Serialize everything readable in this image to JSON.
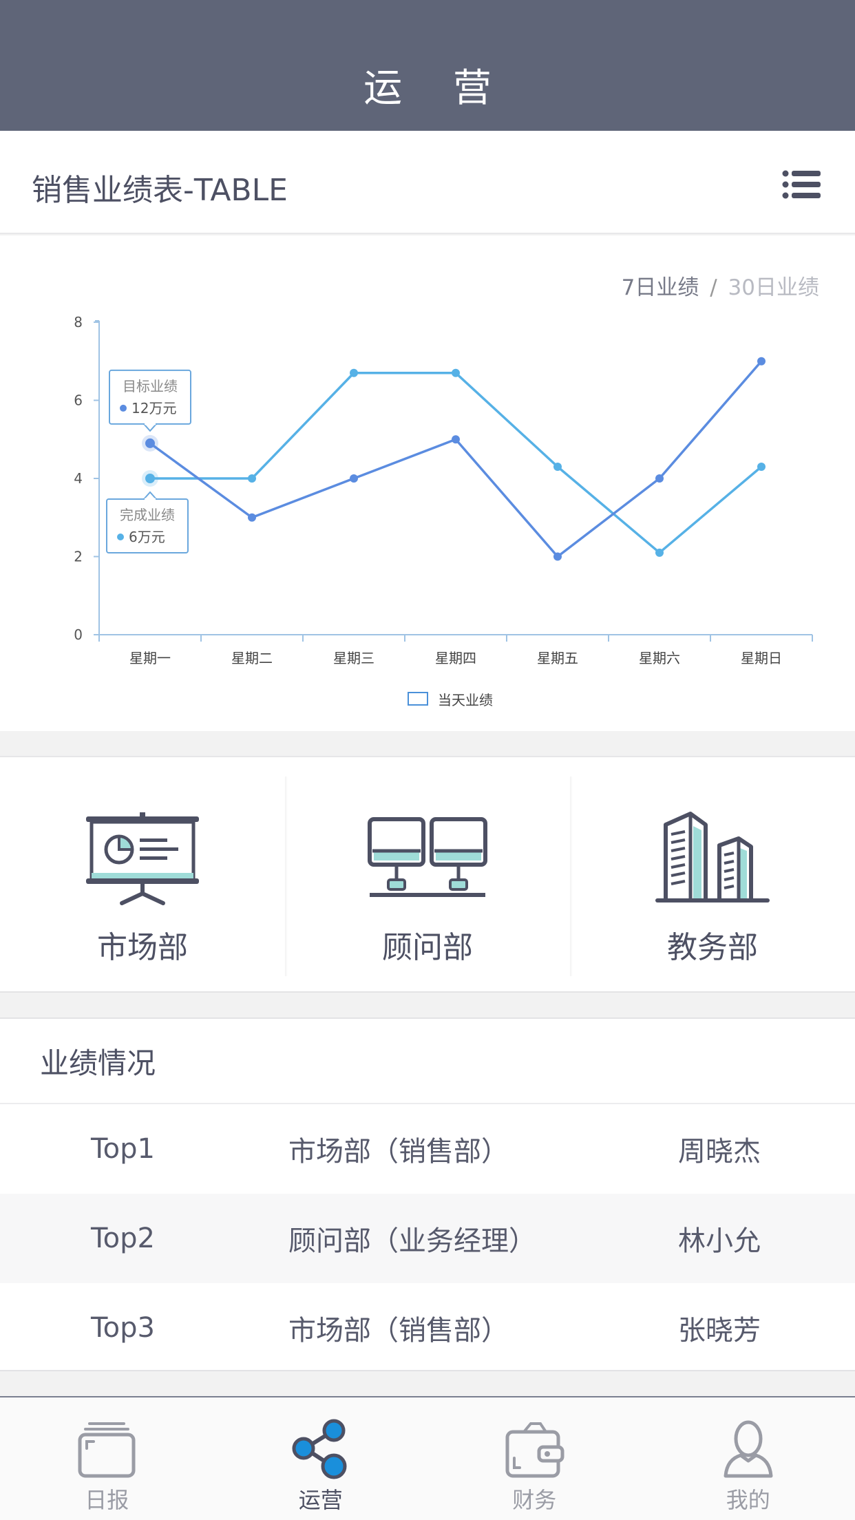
{
  "header": {
    "title": "运 营"
  },
  "card": {
    "title": "销售业绩表-TABLE",
    "menu_icon": "list-icon"
  },
  "range": {
    "active": "7日业绩",
    "separator": "/",
    "inactive": "30日业绩"
  },
  "chart_data": {
    "type": "line",
    "categories": [
      "星期一",
      "星期二",
      "星期三",
      "星期四",
      "星期五",
      "星期六",
      "星期日"
    ],
    "ylim": [
      0,
      8
    ],
    "yticks": [
      0,
      2,
      4,
      6,
      8
    ],
    "grid": false,
    "legend": {
      "label": "当天业绩",
      "placement": "bottom-center"
    },
    "series": [
      {
        "values": [
          4.9,
          3.0,
          4.0,
          5.0,
          2.0,
          4.0,
          7.0
        ],
        "color": "#5b8ce0"
      },
      {
        "values": [
          4.0,
          4.0,
          6.7,
          6.7,
          4.3,
          2.1,
          4.3
        ],
        "color": "#56b1e6"
      }
    ],
    "tooltips": [
      {
        "title": "目标业绩",
        "value": "12万元",
        "color": "#5b8ce0"
      },
      {
        "title": "完成业绩",
        "value": "6万元",
        "color": "#56b1e6"
      }
    ]
  },
  "departments": [
    {
      "label": "市场部",
      "icon": "presentation-board-icon"
    },
    {
      "label": "顾问部",
      "icon": "networked-computers-icon"
    },
    {
      "label": "教务部",
      "icon": "office-buildings-icon"
    }
  ],
  "performance": {
    "title": "业绩情况",
    "rows": [
      {
        "rank": "Top1",
        "dept": "市场部（销售部）",
        "name": "周晓杰"
      },
      {
        "rank": "Top2",
        "dept": "顾问部（业务经理）",
        "name": "林小允"
      },
      {
        "rank": "Top3",
        "dept": "市场部（销售部）",
        "name": "张晓芳"
      }
    ]
  },
  "tabs": [
    {
      "label": "日报",
      "icon": "report-stack-icon",
      "active": false
    },
    {
      "label": "运营",
      "icon": "share-nodes-icon",
      "active": true
    },
    {
      "label": "财务",
      "icon": "wallet-icon",
      "active": false
    },
    {
      "label": "我的",
      "icon": "user-icon",
      "active": false
    }
  ]
}
